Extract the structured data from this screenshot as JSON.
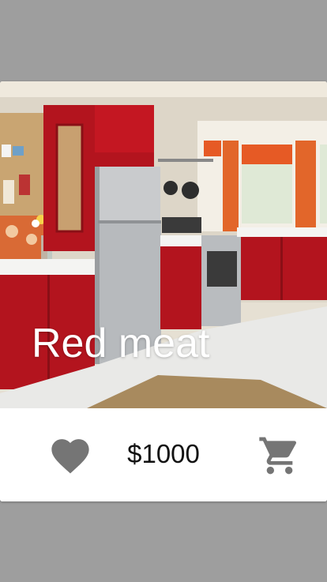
{
  "card": {
    "title": "Red meat",
    "price": "$1000"
  },
  "icons": {
    "favorite": "heart-icon",
    "cart": "shopping-cart-icon"
  },
  "colors": {
    "backdrop": "#9e9e9e",
    "icon": "#757575",
    "title_text": "#ffffff",
    "price_text": "#111111"
  }
}
